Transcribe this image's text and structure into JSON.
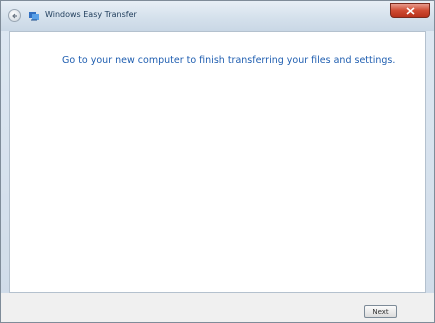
{
  "window": {
    "title": "Windows Easy Transfer"
  },
  "icons": {
    "back": "back-arrow-icon",
    "app": "easy-transfer-icon",
    "close": "close-icon"
  },
  "main": {
    "instruction": "Go to your new computer to finish transferring your files and settings."
  },
  "footer": {
    "next_label": "Next"
  },
  "colors": {
    "instruction_text": "#1f5eb0",
    "close_button": "#cf4b33"
  }
}
